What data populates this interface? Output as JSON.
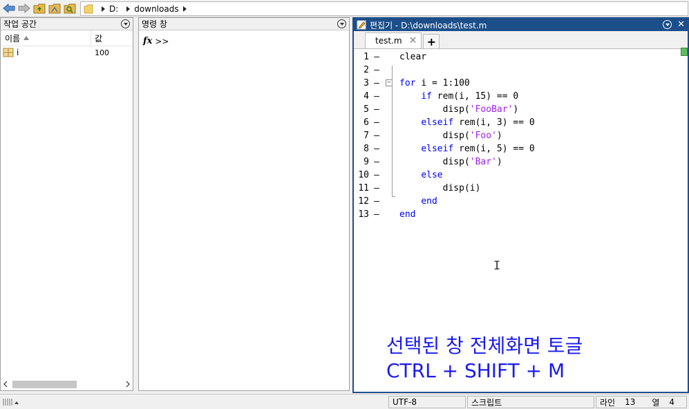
{
  "toolbar": {
    "back_icon": "arrow-left-icon",
    "forward_icon": "arrow-right-icon",
    "address": {
      "drive": "D:",
      "folder": "downloads"
    }
  },
  "workspace": {
    "title": "작업 공간",
    "col_name": "이름",
    "col_value": "값",
    "rows": [
      {
        "name": "i",
        "value": "100"
      }
    ]
  },
  "command_window": {
    "title": "명령 창",
    "prompt": ">>"
  },
  "editor": {
    "title": "편집기 - D:\\downloads\\test.m",
    "tab": "test.m",
    "lines": [
      {
        "n": "1",
        "text": "clear"
      },
      {
        "n": "2",
        "text": ""
      },
      {
        "n": "3",
        "text": "for i = 1:100"
      },
      {
        "n": "4",
        "text": "    if rem(i, 15) == 0"
      },
      {
        "n": "5",
        "text": "        disp('FooBar')"
      },
      {
        "n": "6",
        "text": "    elseif rem(i, 3) == 0"
      },
      {
        "n": "7",
        "text": "        disp('Foo')"
      },
      {
        "n": "8",
        "text": "    elseif rem(i, 5) == 0"
      },
      {
        "n": "9",
        "text": "        disp('Bar')"
      },
      {
        "n": "10",
        "text": "    else"
      },
      {
        "n": "11",
        "text": "        disp(i)"
      },
      {
        "n": "12",
        "text": "    end"
      },
      {
        "n": "13",
        "text": "end"
      }
    ],
    "overlay": {
      "line1": "선택된 창 전체화면 토글",
      "line2": "CTRL + SHIFT + M"
    }
  },
  "status": {
    "encoding": "UTF-8",
    "type": "스크립트",
    "line_label": "라인",
    "line_value": "13",
    "col_label": "열",
    "col_value": "4"
  },
  "colors": {
    "editor_title_bg": "#1c4f8a",
    "keyword": "#0000ff",
    "string": "#a020f0",
    "overlay_text": "#1a1aee"
  }
}
